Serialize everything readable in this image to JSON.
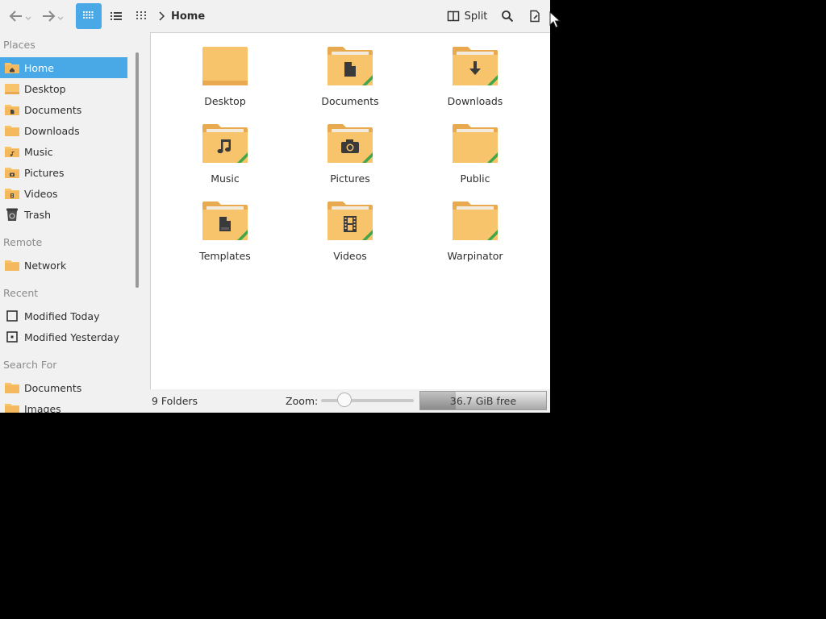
{
  "toolbar": {
    "breadcrumb": "Home",
    "split_label": "Split"
  },
  "sidebar": {
    "places_heading": "Places",
    "places": [
      {
        "label": "Home",
        "icon": "home-folder-icon",
        "selected": true
      },
      {
        "label": "Desktop",
        "icon": "folder-icon"
      },
      {
        "label": "Documents",
        "icon": "documents-folder-icon"
      },
      {
        "label": "Downloads",
        "icon": "folder-icon"
      },
      {
        "label": "Music",
        "icon": "music-folder-icon"
      },
      {
        "label": "Pictures",
        "icon": "pictures-folder-icon"
      },
      {
        "label": "Videos",
        "icon": "videos-folder-icon"
      },
      {
        "label": "Trash",
        "icon": "trash-icon"
      }
    ],
    "remote_heading": "Remote",
    "remote": [
      {
        "label": "Network",
        "icon": "folder-icon"
      }
    ],
    "recent_heading": "Recent",
    "recent": [
      {
        "label": "Modified Today",
        "icon": "calendar-today-icon"
      },
      {
        "label": "Modified Yesterday",
        "icon": "calendar-yesterday-icon"
      }
    ],
    "search_heading": "Search For",
    "search": [
      {
        "label": "Documents",
        "icon": "folder-icon"
      },
      {
        "label": "Images",
        "icon": "folder-icon"
      }
    ]
  },
  "files": [
    {
      "name": "Desktop",
      "icon": "desktop-folder-icon"
    },
    {
      "name": "Documents",
      "icon": "documents-folder-icon"
    },
    {
      "name": "Downloads",
      "icon": "downloads-folder-icon"
    },
    {
      "name": "Music",
      "icon": "music-folder-icon"
    },
    {
      "name": "Pictures",
      "icon": "pictures-folder-icon"
    },
    {
      "name": "Public",
      "icon": "public-folder-icon"
    },
    {
      "name": "Templates",
      "icon": "templates-folder-icon"
    },
    {
      "name": "Videos",
      "icon": "videos-folder-icon"
    },
    {
      "name": "Warpinator",
      "icon": "warpinator-folder-icon"
    }
  ],
  "status": {
    "folder_count": "9 Folders",
    "zoom_label": "Zoom:",
    "zoom_level": 0.25,
    "free_space": "36.7 GiB free",
    "disk_used_fraction": 0.28
  },
  "colors": {
    "accent": "#48a9e6",
    "folder": "#f7c36b",
    "folder_dark": "#e9a94f",
    "share_stripe": "#3fa64a"
  }
}
